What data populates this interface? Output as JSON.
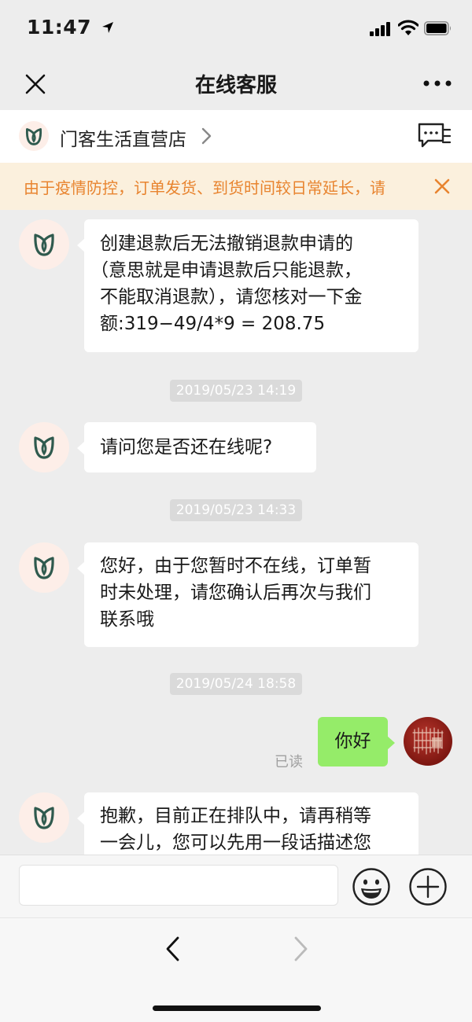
{
  "status_bar": {
    "time": "11:47"
  },
  "nav": {
    "title": "在线客服",
    "close_icon": "close-icon",
    "more_icon": "more-icon"
  },
  "shop": {
    "name": "门客生活直营店",
    "logo_icon": "tulip-logo-icon",
    "cs_icon": "customer-service-icon"
  },
  "notice": {
    "text": "由于疫情防控，订单发货、到货时间较日常延长，请",
    "color": "#e8842f"
  },
  "messages": [
    {
      "from": "agent",
      "lines": [
        "创建退款后无法撤销退款申请的",
        "（意思就是申请退款后只能退款，",
        "不能取消退款），请您核对一下金",
        "额:319−49/4*9 = 208.75"
      ]
    },
    {
      "from": "timestamp",
      "text": "2019/05/23 14:19"
    },
    {
      "from": "agent",
      "lines": [
        "请问您是否还在线呢?"
      ]
    },
    {
      "from": "timestamp",
      "text": "2019/05/23 14:33"
    },
    {
      "from": "agent",
      "lines": [
        "您好，由于您暂时不在线，订单暂",
        "时未处理，请您确认后再次与我们",
        "联系哦"
      ]
    },
    {
      "from": "timestamp",
      "text": "2019/05/24 18:58"
    },
    {
      "from": "user",
      "lines": [
        "你好"
      ],
      "status": "已读"
    },
    {
      "from": "agent",
      "lines": [
        "抱歉，目前正在排队中，请再稍等",
        "一会儿，您可以先用一段话描述您"
      ]
    }
  ],
  "input": {
    "value": "",
    "placeholder": ""
  },
  "colors": {
    "bubble_user": "#95ec69",
    "bubble_agent": "#ffffff",
    "background": "#ededed",
    "logo": "#2f5a4e"
  }
}
